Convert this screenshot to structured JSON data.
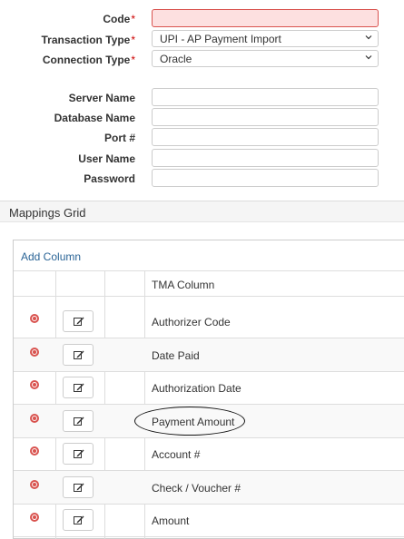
{
  "form": {
    "code": {
      "label": "Code",
      "required": true,
      "value": ""
    },
    "transaction_type": {
      "label": "Transaction Type",
      "required": true,
      "value": "UPI - AP Payment Import"
    },
    "connection_type": {
      "label": "Connection Type",
      "required": true,
      "value": "Oracle"
    },
    "server_name": {
      "label": "Server Name",
      "value": ""
    },
    "database_name": {
      "label": "Database Name",
      "value": ""
    },
    "port": {
      "label": "Port #",
      "value": ""
    },
    "user_name": {
      "label": "User Name",
      "value": ""
    },
    "password": {
      "label": "Password",
      "value": ""
    },
    "required_marker": "*"
  },
  "mappings": {
    "title": "Mappings Grid",
    "add_column_label": "Add Column",
    "column_header": "TMA Column",
    "rows": [
      {
        "label": "Authorizer Code"
      },
      {
        "label": "Date Paid"
      },
      {
        "label": "Authorization Date"
      },
      {
        "label": "Payment Amount",
        "highlighted": true
      },
      {
        "label": "Account #"
      },
      {
        "label": "Check / Voucher #"
      },
      {
        "label": "Amount"
      }
    ]
  },
  "icons": {
    "delete": "remove-circle-icon",
    "edit": "edit-icon",
    "dropdown": "chevron-down-icon"
  },
  "colors": {
    "required": "#cc0000",
    "error_field": "#fde0e0",
    "link": "#2a6496",
    "delete_icon": "#d9534f"
  }
}
